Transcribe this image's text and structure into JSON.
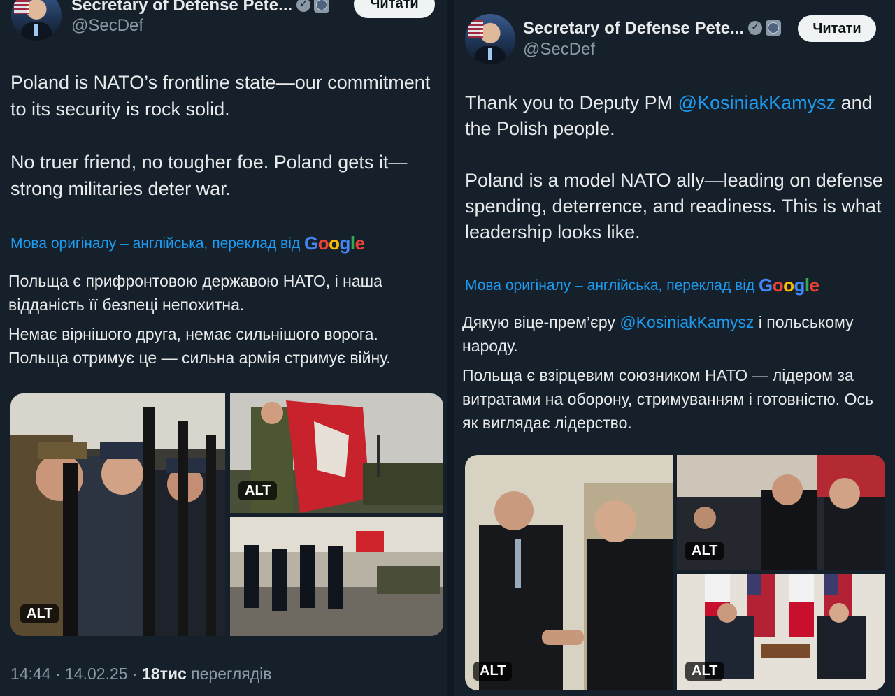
{
  "left": {
    "author": {
      "name": "Secretary of Defense Pete...",
      "handle": "@SecDef"
    },
    "follow_label": "Читати",
    "tweet_paragraphs": [
      "Poland is NATO’s frontline state—our commitment to its security is rock solid.",
      "No truer friend, no tougher foe. Poland gets it—strong militaries deter war."
    ],
    "translation_note": "Мова оригіналу – англійська, переклад від",
    "google_label": "Google",
    "translation_paragraphs": [
      "Польща є прифронтовою державою НАТО, і наша відданість її безпеці непохитна.",
      "Немає вірнішого друга, немає сильнішого ворога. Польща отримує це — сильна армія стримує війну."
    ],
    "alt_label": "ALT",
    "meta": {
      "time": "14:44",
      "date": "14.02.25",
      "views_count": "18тис",
      "views_label": "переглядів"
    }
  },
  "right": {
    "author": {
      "name": "Secretary of Defense Pete...",
      "handle": "@SecDef"
    },
    "follow_label": "Читати",
    "tweet_p1_pre": "Thank you to Deputy PM ",
    "tweet_mention": "@KosiniakKamysz",
    "tweet_p1_post": " and the Polish people.",
    "tweet_p2": "Poland is a model NATO ally—leading on defense spending, deterrence, and readiness. This is what leadership looks like.",
    "translation_note": "Мова оригіналу – англійська, переклад від",
    "google_label": "Google",
    "trans_p1_pre": "Дякую віце-прем’єру ",
    "trans_mention": "@KosiniakKamysz",
    "trans_p1_post": " і польському народу.",
    "trans_p2": "Польща є взірцевим союзником НАТО — лідером за витратами на оборону, стримуванням і готовністю. Ось як виглядає лідерство.",
    "alt_label": "ALT"
  },
  "colors": {
    "background": "#15202b",
    "text": "#e7e9ea",
    "muted": "#8b98a5",
    "link": "#1d9bf0"
  }
}
